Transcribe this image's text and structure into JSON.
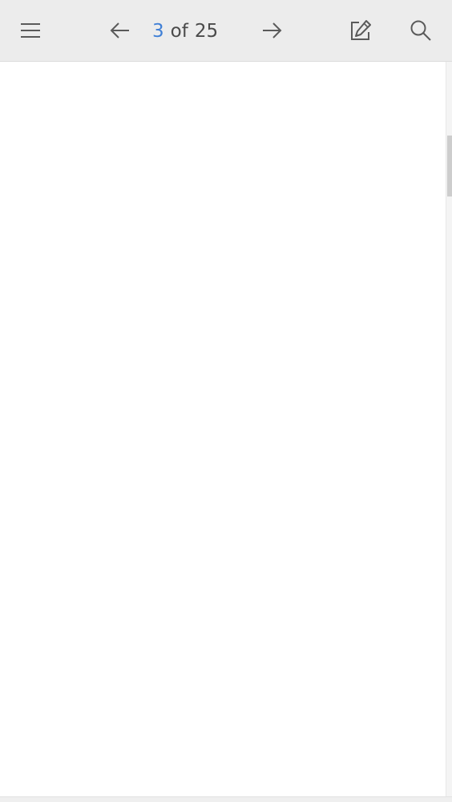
{
  "toolbar": {
    "menu_icon": "hamburger-menu-icon",
    "prev_icon": "arrow-left-icon",
    "next_icon": "arrow-right-icon",
    "edit_icon": "edit-pencil-icon",
    "search_icon": "search-icon",
    "page": {
      "current": "3",
      "of_label": "of",
      "total": "25"
    }
  },
  "document": {
    "page_content": ""
  },
  "colors": {
    "toolbar_bg": "#ececec",
    "accent": "#3f7fd6",
    "icon": "#5a5a5a",
    "text": "#4a4a4a"
  }
}
